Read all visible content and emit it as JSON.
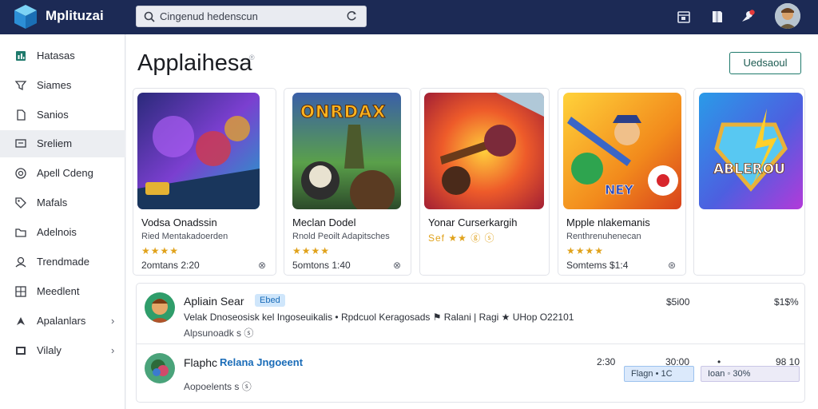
{
  "app": {
    "brand": "Mplituzai"
  },
  "search": {
    "text": "Cingenud hedenscun"
  },
  "sidebar": {
    "items": [
      {
        "label": "Hatasas",
        "icon": "bar-chart-icon",
        "chevron": ""
      },
      {
        "label": "Siames",
        "icon": "filter-icon",
        "chevron": ""
      },
      {
        "label": "Sanios",
        "icon": "file-icon",
        "chevron": ""
      },
      {
        "label": "Sreliem",
        "icon": "monitor-icon",
        "chevron": ""
      },
      {
        "label": "Apell Cdeng",
        "icon": "globe-icon",
        "chevron": ""
      },
      {
        "label": "Mafals",
        "icon": "tag-icon",
        "chevron": ""
      },
      {
        "label": "Adelnois",
        "icon": "folder-icon",
        "chevron": ""
      },
      {
        "label": "Trendmade",
        "icon": "user-icon",
        "chevron": ""
      },
      {
        "label": "Meedlent",
        "icon": "grid-icon",
        "chevron": ""
      },
      {
        "label": "Apalanlars",
        "icon": "cursor-icon",
        "chevron": "›"
      },
      {
        "label": "Vilaly",
        "icon": "screen-icon",
        "chevron": "›"
      }
    ]
  },
  "main": {
    "title": "Applaihesa",
    "title_mark": "®",
    "action_button": "Uedsaoul",
    "cards": [
      {
        "title": "Vodsa Onadssin",
        "subtitle": "Ried Mentakadoerden",
        "stars": "★★★★",
        "price": "2omtans 2:20",
        "icon": "⊗",
        "accent": "#6a3cc2"
      },
      {
        "title": "Meclan Dodel",
        "subtitle": "Rnold Peoilt Adapitsches",
        "stars": "★★★★",
        "price": "5omtons 1:40",
        "icon": "⊗",
        "accent": "#e7a623",
        "art_text": "ONRDAX"
      },
      {
        "title": "Yonar Curserkargih",
        "subtitle": "",
        "stars": "Sef ★★ ⓖ ⓢ",
        "price": "",
        "icon": "",
        "accent": "#d9452d"
      },
      {
        "title": "Mpple nlakemanis",
        "subtitle": "Renthrenuhenecan",
        "stars": "★★★★",
        "price": "Somtems $1:4",
        "icon": "⊛",
        "accent": "#f0b21f",
        "art_text": "NEY"
      },
      {
        "title": "",
        "subtitle": "",
        "stars": "",
        "price": "",
        "icon": "",
        "accent": "#3a6fe0",
        "art_text": "ABLEROU"
      }
    ],
    "list": [
      {
        "title": "Apliain Sear",
        "tag": "Ebed",
        "desc": "Velak Dnoseosisk kel Ingoseuikalis • Rpdcuol Keragosads ⚑ Ralani | Ragi ★ UHop O22101",
        "meta": "Alpsunoadk s ⓢ",
        "nums": [
          "$5i00",
          "$1$%"
        ]
      },
      {
        "title": "Flaphc",
        "tag": "Relana Jngoeent",
        "desc": "",
        "meta": "Aopoelents s ⓢ",
        "nums": [
          "2:30",
          "30:00",
          "•",
          "98 10"
        ],
        "pills": [
          "Flagn • 1C",
          "Ioan  ◦ 30%"
        ]
      }
    ]
  },
  "colors": {
    "topbar": "#1c2a55",
    "accent": "#1f7a6c",
    "star": "#e0a21b",
    "tag_bg": "#cfe6fb"
  }
}
